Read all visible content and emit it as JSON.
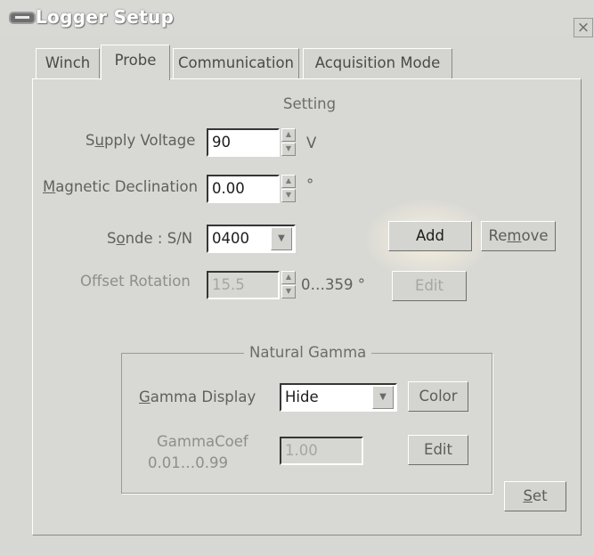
{
  "window": {
    "title": "Logger Setup",
    "close_glyph": "×"
  },
  "tabs": [
    {
      "label": "Winch"
    },
    {
      "label": "Probe",
      "active": true
    },
    {
      "label": "Communication"
    },
    {
      "label": "Acquisition Mode"
    }
  ],
  "setting": {
    "title": "Setting",
    "supply_voltage": {
      "label_pre": "S",
      "label_acc": "u",
      "label_post": "pply Voltage",
      "value": "90",
      "unit": "V"
    },
    "magnetic_declination": {
      "label_acc": "M",
      "label_post": "agnetic Declination",
      "value": "0.00",
      "unit": "°"
    },
    "sonde": {
      "label_pre": "S",
      "label_acc": "o",
      "label_post": "nde : S/N",
      "value": "0400"
    },
    "offset_rotation": {
      "label": "Offset Rotation",
      "value": "15.5",
      "range": "0…359 °"
    },
    "buttons": {
      "add": "Add",
      "remove_pre": "Re",
      "remove_acc": "m",
      "remove_post": "ove",
      "edit": "Edit"
    }
  },
  "natural_gamma": {
    "title": "Natural Gamma",
    "display": {
      "label_acc": "G",
      "label_post": "amma Display",
      "value": "Hide"
    },
    "color_button": "Color",
    "coef": {
      "label_line1": "GammaCoef",
      "label_line2": "0.01…0.99",
      "value": "1.00"
    },
    "edit_button": "Edit"
  },
  "set_button": {
    "acc": "S",
    "post": "et"
  },
  "icons": {
    "app": "logger-icon",
    "spin_up": "▲",
    "spin_down": "▼",
    "dropdown": "▼"
  }
}
